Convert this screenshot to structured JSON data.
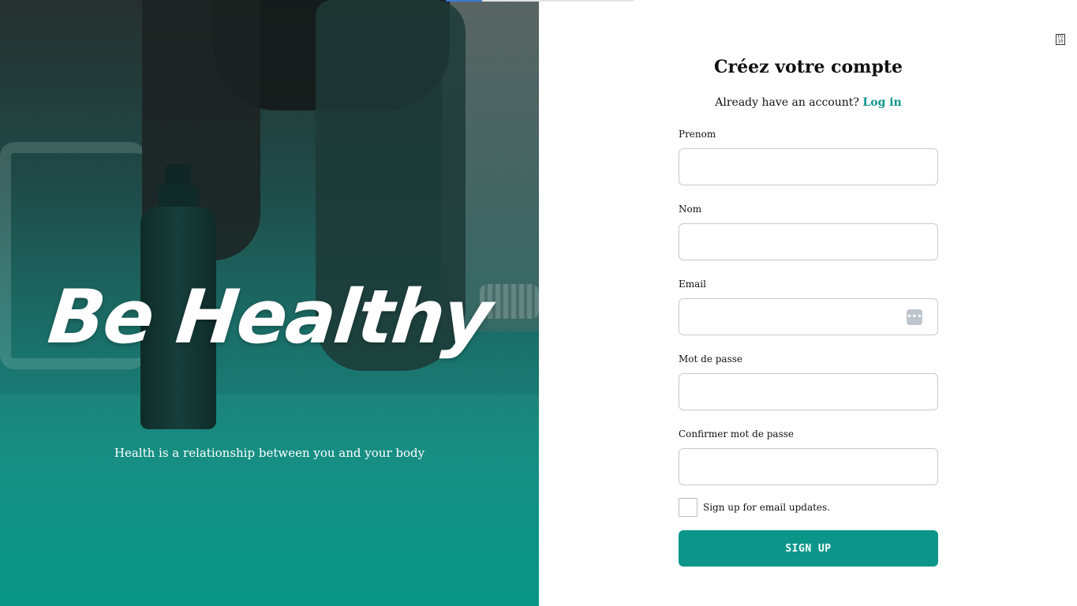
{
  "hero": {
    "title": "Be Healthy",
    "subtitle": "Health is a relationship between you and your body"
  },
  "form": {
    "title": "Créez votre compte",
    "login_prompt": "Already have an account?",
    "login_link": "Log in",
    "fields": [
      {
        "label": "Prenom",
        "value": "",
        "placeholder": ""
      },
      {
        "label": "Nom",
        "value": "",
        "placeholder": ""
      },
      {
        "label": "Email",
        "value": "",
        "placeholder": "",
        "icon": "password-manager-icon"
      },
      {
        "label": "Mot de passe",
        "value": "",
        "placeholder": ""
      },
      {
        "label": "Confirmer mot de passe",
        "value": "",
        "placeholder": ""
      }
    ],
    "checkbox_label": "Sign up for email updates.",
    "checkbox_checked": false,
    "submit_label": "SIGN UP"
  },
  "colors": {
    "accent": "#0c968a",
    "hero_gradient_bottom": "#0b9685"
  }
}
